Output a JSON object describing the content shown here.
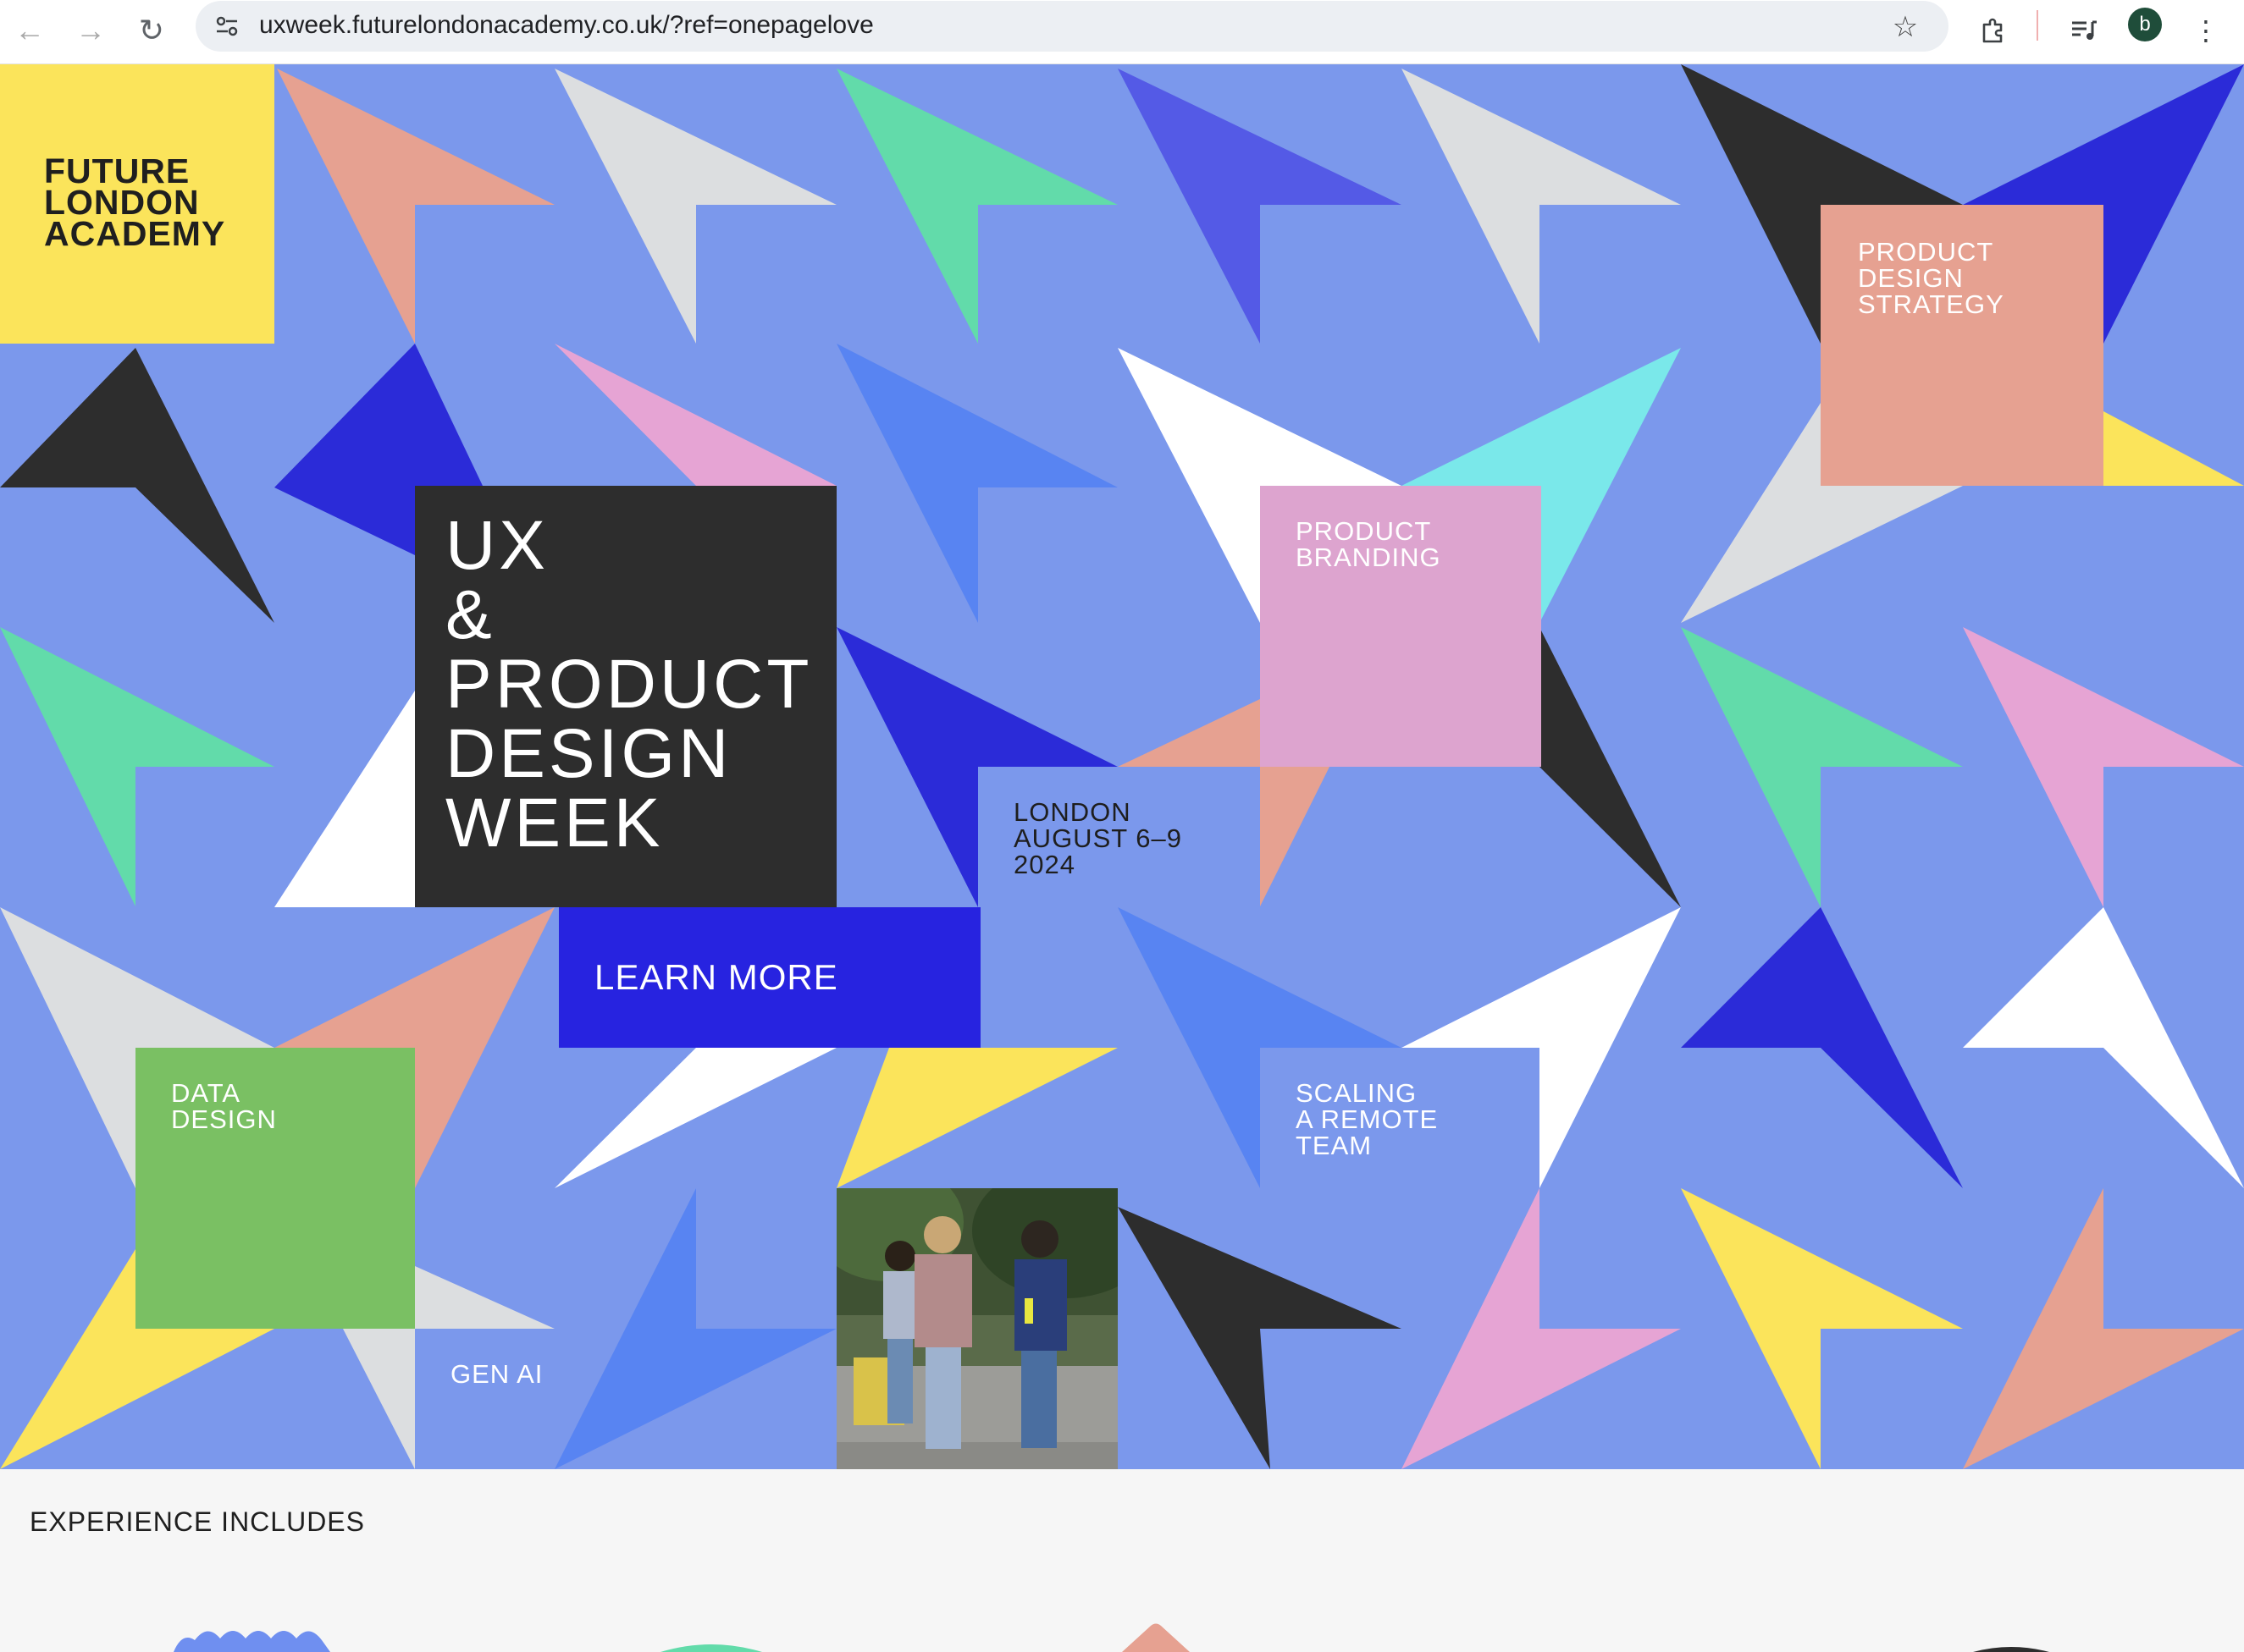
{
  "browser": {
    "url": "uxweek.futurelondonacademy.co.uk/?ref=onepagelove",
    "avatar_letter": "b",
    "icons": [
      "back-icon",
      "forward-icon",
      "reload-icon",
      "site-info-icon",
      "bookmark-star-icon",
      "extensions-icon",
      "media-control-icon",
      "more-menu-icon"
    ]
  },
  "logo": {
    "lines": [
      "FUTURE",
      "LONDON",
      "ACADEMY"
    ]
  },
  "hero": {
    "title_lines": [
      "UX",
      "&",
      "PRODUCT",
      "DESIGN",
      "WEEK"
    ],
    "cta_label": "LEARN MORE",
    "event_info": [
      "LONDON",
      "AUGUST 6–9",
      "2024"
    ]
  },
  "topics": {
    "product_design_strategy": [
      "PRODUCT",
      "DESIGN",
      "STRATEGY"
    ],
    "product_branding": [
      "PRODUCT",
      "BRANDING"
    ],
    "data_design": [
      "DATA",
      "DESIGN"
    ],
    "scaling_remote_team": [
      "SCALING",
      "A REMOTE",
      "TEAM"
    ],
    "gen_ai": [
      "GEN AI"
    ]
  },
  "section": {
    "heading": "EXPERIENCE INCLUDES"
  },
  "colors": {
    "hero_bg": "#7b98ec",
    "logo_yellow": "#fbe45b",
    "title_dark": "#2d2d2d",
    "cta_blue": "#2723e0",
    "salmon": "#e6a191",
    "pink": "#dda4cf",
    "green": "#7ac063",
    "mint": "#62dbaa",
    "cyan": "#7ae8ea",
    "grey": "#dcdee0",
    "royal": "#2b2bd8",
    "mid_blue": "#5884f2",
    "indigo": "#545ae6"
  }
}
